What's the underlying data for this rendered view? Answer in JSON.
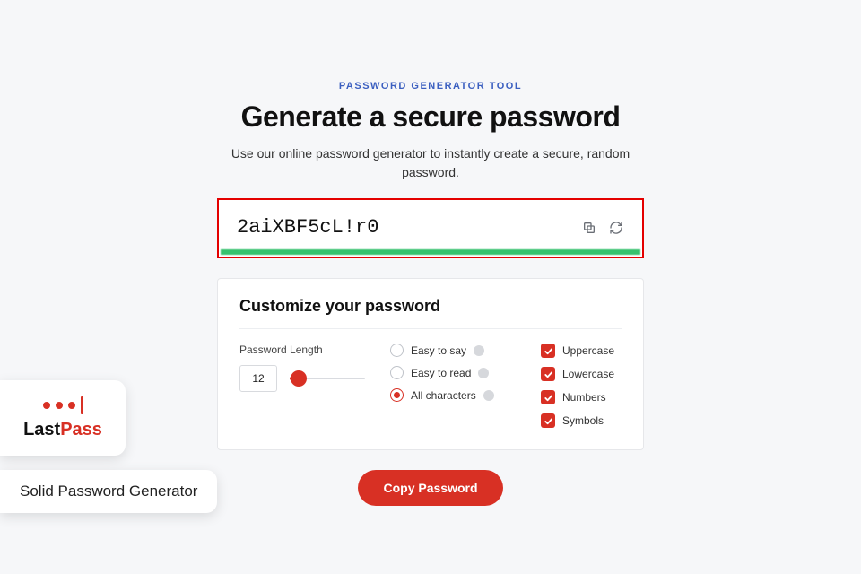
{
  "header": {
    "eyebrow": "PASSWORD GENERATOR TOOL",
    "title": "Generate a secure password",
    "subtitle": "Use our online password generator to instantly create a secure, random password."
  },
  "password": {
    "value": "2aiXBF5cL!r0"
  },
  "panel": {
    "title": "Customize your password",
    "length": {
      "label": "Password Length",
      "value": "12"
    },
    "modes": {
      "easy_say": "Easy to say",
      "easy_read": "Easy to read",
      "all_chars": "All characters",
      "selected": "all_chars"
    },
    "checks": {
      "uppercase": "Uppercase",
      "lowercase": "Lowercase",
      "numbers": "Numbers",
      "symbols": "Symbols"
    }
  },
  "actions": {
    "copy_label": "Copy Password"
  },
  "brand": {
    "name_a": "Last",
    "name_b": "Pass"
  },
  "caption": "Solid Password Generator",
  "colors": {
    "accent": "#d83024",
    "highlight_border": "#e40000",
    "strength_bar": "#36c26e"
  }
}
